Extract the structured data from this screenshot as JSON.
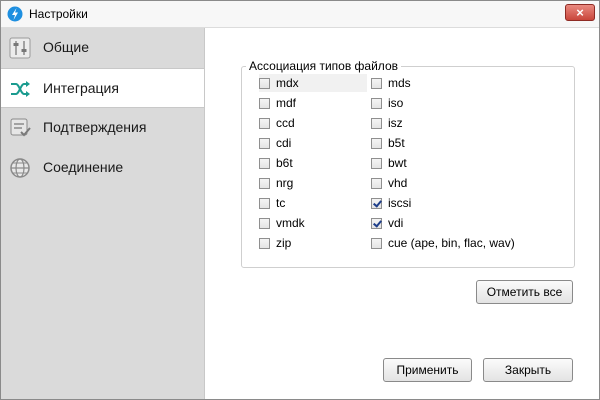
{
  "window": {
    "title": "Настройки",
    "close_label": "×"
  },
  "sidebar": {
    "items": [
      {
        "label": "Общие",
        "icon": "sliders-icon",
        "active": false
      },
      {
        "label": "Интеграция",
        "icon": "shuffle-icon",
        "active": true
      },
      {
        "label": "Подтверждения",
        "icon": "checklist-icon",
        "active": false
      },
      {
        "label": "Соединение",
        "icon": "globe-icon",
        "active": false
      }
    ]
  },
  "file_association": {
    "title": "Ассоциация типов файлов",
    "left_column": [
      {
        "label": "mdx",
        "checked": false
      },
      {
        "label": "mdf",
        "checked": false
      },
      {
        "label": "ccd",
        "checked": false
      },
      {
        "label": "cdi",
        "checked": false
      },
      {
        "label": "b6t",
        "checked": false
      },
      {
        "label": "nrg",
        "checked": false
      },
      {
        "label": "tc",
        "checked": false
      },
      {
        "label": "vmdk",
        "checked": false
      },
      {
        "label": "zip",
        "checked": false
      }
    ],
    "right_column": [
      {
        "label": "mds",
        "checked": false
      },
      {
        "label": "iso",
        "checked": false
      },
      {
        "label": "isz",
        "checked": false
      },
      {
        "label": "b5t",
        "checked": false
      },
      {
        "label": "bwt",
        "checked": false
      },
      {
        "label": "vhd",
        "checked": false
      },
      {
        "label": "iscsi",
        "checked": true
      },
      {
        "label": "vdi",
        "checked": true
      },
      {
        "label": "cue (ape, bin, flac, wav)",
        "checked": false
      }
    ]
  },
  "buttons": {
    "select_all": "Отметить все",
    "apply": "Применить",
    "close": "Закрыть"
  },
  "colors": {
    "app_icon": "#1e8fe0",
    "close_button": "#c9463b",
    "shuffle_icon": "#1a9b8f"
  }
}
